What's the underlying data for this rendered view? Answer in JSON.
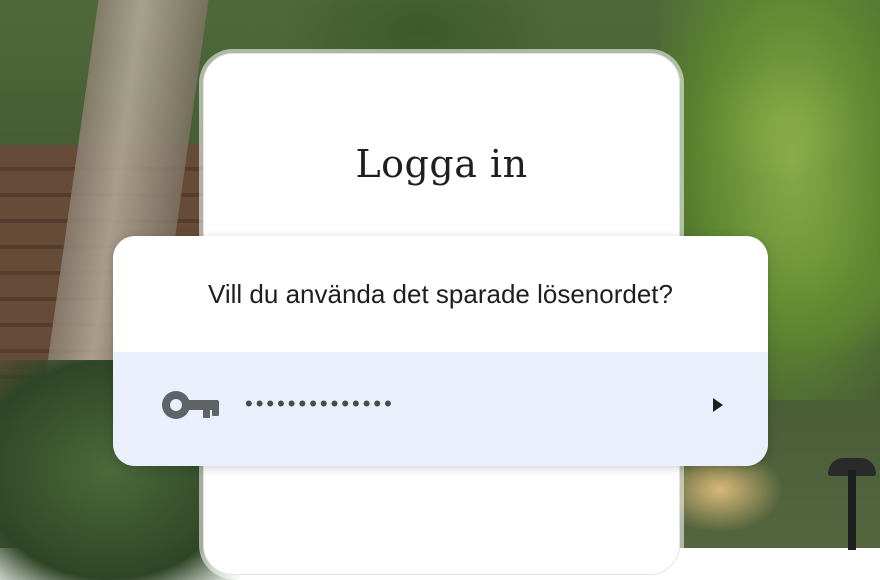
{
  "screen": {
    "title": "Logga in"
  },
  "password_prompt": {
    "question": "Vill du använda det sparade lösenordet?",
    "saved_password_mask": "••••••••••••••",
    "key_icon": "key-icon",
    "chevron_icon": "chevron-right-icon",
    "accent_color": "#e9f0fc",
    "icon_color": "#5f6368"
  }
}
